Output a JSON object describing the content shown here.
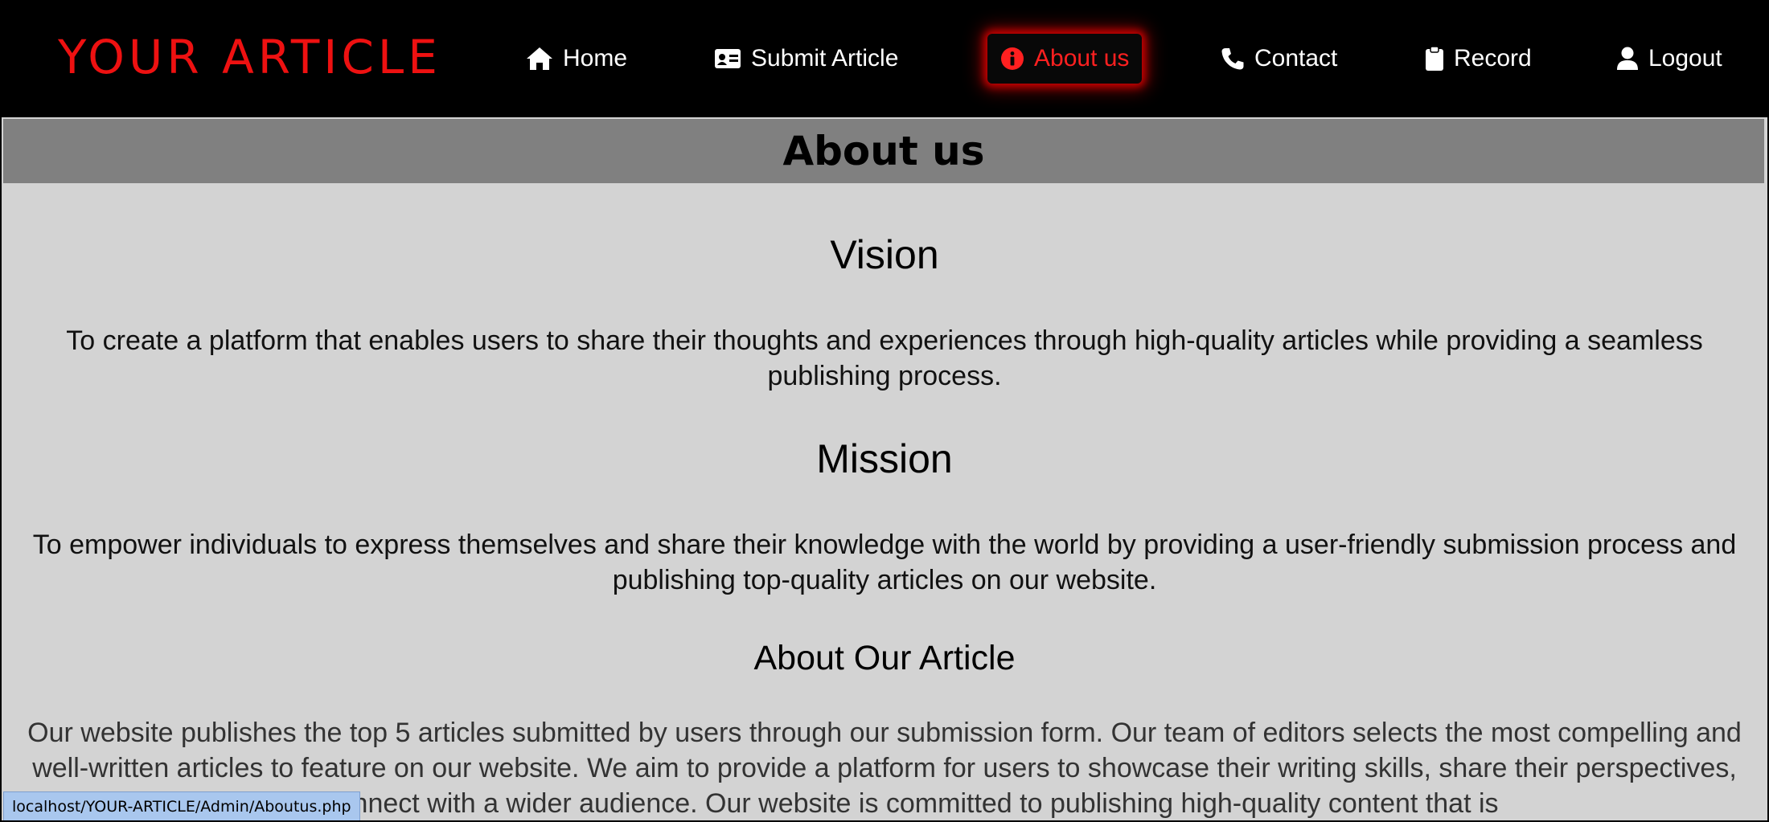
{
  "brand": {
    "title": "YOUR ARTICLE",
    "color": "#ee1111"
  },
  "nav": {
    "home": "Home",
    "submit": "Submit Article",
    "about": "About us",
    "contact": "Contact",
    "record": "Record",
    "logout": "Logout",
    "active_item": "About us"
  },
  "icons": {
    "home": "home-icon",
    "submit": "id-card-icon",
    "about": "info-circle-icon",
    "contact": "phone-icon",
    "record": "clipboard-icon",
    "logout": "user-icon"
  },
  "page": {
    "heading": "About us"
  },
  "sections": {
    "vision": {
      "title": "Vision",
      "text": "To create a platform that enables users to share their thoughts and experiences through high-quality articles while providing a seamless publishing process."
    },
    "mission": {
      "title": "Mission",
      "text": "To empower individuals to express themselves and share their knowledge with the world by providing a user-friendly submission process and publishing top-quality articles on our website."
    },
    "about_article": {
      "title": "About Our Article",
      "text": "Our website publishes the top 5 articles submitted by users through our submission form. Our team of editors selects the most compelling and well-written articles to feature on our website. We aim to provide a platform for users to showcase their writing skills, share their perspectives, and connect with a wider audience. Our website is committed to publishing high-quality content that is"
    }
  },
  "status_bar": {
    "url": "localhost/YOUR-ARTICLE/Admin/Aboutus.php"
  },
  "colors": {
    "topbar": "#000000",
    "accent": "#ff2020",
    "header_band": "#808080",
    "content_bg": "#d3d3d3"
  }
}
